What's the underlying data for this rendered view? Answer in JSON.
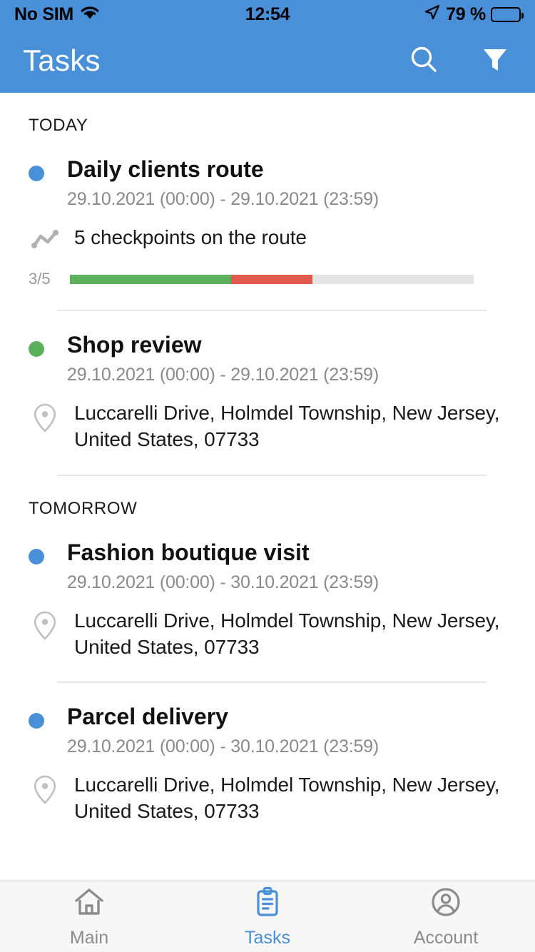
{
  "status_bar": {
    "carrier": "No SIM",
    "wifi_icon": "wifi-icon",
    "time": "12:54",
    "location_icon": "location-arrow-icon",
    "battery_percent": "79 %",
    "battery_level": 79
  },
  "app_bar": {
    "title": "Tasks",
    "search_icon": "search-icon",
    "filter_icon": "filter-funnel-icon"
  },
  "colors": {
    "accent": "#4a90d9",
    "status_blue": "#4a90d9",
    "status_green": "#5cb05c",
    "progress_green": "#5cb05c",
    "progress_red": "#e05a4e",
    "progress_track": "#e4e4e4",
    "muted_text": "#8a8a8a"
  },
  "sections": [
    {
      "label": "TODAY",
      "tasks": [
        {
          "title": "Daily clients route",
          "dates": "29.10.2021 (00:00) - 29.10.2021 (23:59)",
          "status_color": "#4a90d9",
          "meta_icon": "route-chart-icon",
          "meta_text": "5 checkpoints on the route",
          "progress": {
            "label": "3/5",
            "completed": 3,
            "total": 5,
            "green_percent": 40,
            "red_percent": 20
          }
        },
        {
          "title": "Shop review",
          "dates": "29.10.2021 (00:00) - 29.10.2021 (23:59)",
          "status_color": "#5cb05c",
          "meta_icon": "location-pin-icon",
          "meta_text": "Luccarelli Drive, Holmdel Township, New Jersey, United States, 07733"
        }
      ]
    },
    {
      "label": "TOMORROW",
      "tasks": [
        {
          "title": "Fashion boutique visit",
          "dates": "29.10.2021 (00:00) - 30.10.2021 (23:59)",
          "status_color": "#4a90d9",
          "meta_icon": "location-pin-icon",
          "meta_text": "Luccarelli Drive, Holmdel Township, New Jersey, United States, 07733"
        },
        {
          "title": "Parcel delivery",
          "dates": "29.10.2021 (00:00) - 30.10.2021 (23:59)",
          "status_color": "#4a90d9",
          "meta_icon": "location-pin-icon",
          "meta_text": "Luccarelli Drive, Holmdel Township, New Jersey, United States, 07733"
        }
      ]
    }
  ],
  "tab_bar": {
    "items": [
      {
        "label": "Main",
        "icon": "home-icon",
        "active": false
      },
      {
        "label": "Tasks",
        "icon": "clipboard-icon",
        "active": true
      },
      {
        "label": "Account",
        "icon": "account-circle-icon",
        "active": false
      }
    ]
  }
}
